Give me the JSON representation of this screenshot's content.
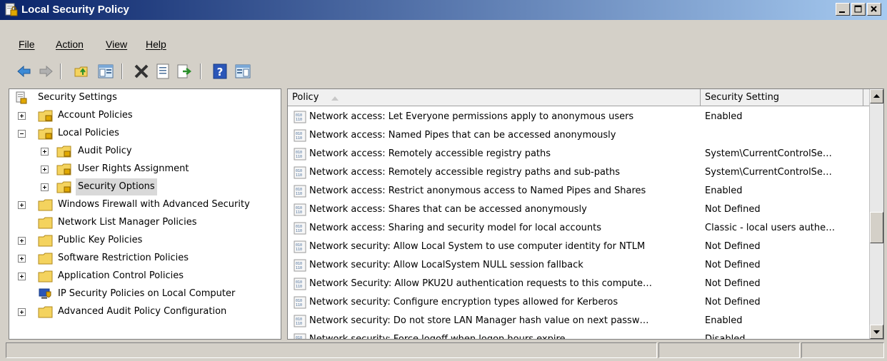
{
  "window": {
    "title": "Local Security Policy"
  },
  "menu": {
    "file": "File",
    "action": "Action",
    "view": "View",
    "help": "Help"
  },
  "toolbar": {
    "icons": [
      "back-arrow-icon",
      "forward-arrow-icon",
      "up-one-level-icon",
      "show-hide-console-tree-icon",
      "delete-icon",
      "properties-icon",
      "export-list-icon",
      "help-icon",
      "show-hide-action-pane-icon"
    ]
  },
  "tree": {
    "root": "Security Settings",
    "items": [
      {
        "label": "Account Policies",
        "expander": "+"
      },
      {
        "label": "Local Policies",
        "expander": "-"
      },
      {
        "label": "Audit Policy",
        "expander": "+"
      },
      {
        "label": "User Rights Assignment",
        "expander": "+"
      },
      {
        "label": "Security Options",
        "expander": "+",
        "selected": true
      },
      {
        "label": "Windows Firewall with Advanced Security",
        "expander": "+"
      },
      {
        "label": "Network List Manager Policies",
        "expander": ""
      },
      {
        "label": "Public Key Policies",
        "expander": "+"
      },
      {
        "label": "Software Restriction Policies",
        "expander": "+"
      },
      {
        "label": "Application Control Policies",
        "expander": "+"
      },
      {
        "label": "IP Security Policies on Local Computer",
        "expander": ""
      },
      {
        "label": "Advanced Audit Policy Configuration",
        "expander": "+"
      }
    ]
  },
  "list": {
    "columns": {
      "policy": "Policy",
      "setting": "Security Setting"
    },
    "rows": [
      {
        "policy": "Network access: Let Everyone permissions apply to anonymous users",
        "setting": "Enabled"
      },
      {
        "policy": "Network access: Named Pipes that can be accessed anonymously",
        "setting": ""
      },
      {
        "policy": "Network access: Remotely accessible registry paths",
        "setting": "System\\CurrentControlSe…"
      },
      {
        "policy": "Network access: Remotely accessible registry paths and sub-paths",
        "setting": "System\\CurrentControlSe…"
      },
      {
        "policy": "Network access: Restrict anonymous access to Named Pipes and Shares",
        "setting": "Enabled"
      },
      {
        "policy": "Network access: Shares that can be accessed anonymously",
        "setting": "Not Defined"
      },
      {
        "policy": "Network access: Sharing and security model for local accounts",
        "setting": "Classic - local users authe…"
      },
      {
        "policy": "Network security: Allow Local System to use computer identity for NTLM",
        "setting": "Not Defined"
      },
      {
        "policy": "Network security: Allow LocalSystem NULL session fallback",
        "setting": "Not Defined"
      },
      {
        "policy": "Network Security: Allow PKU2U authentication requests to this compute…",
        "setting": "Not Defined"
      },
      {
        "policy": "Network security: Configure encryption types allowed for Kerberos",
        "setting": "Not Defined"
      },
      {
        "policy": "Network security: Do not store LAN Manager hash value on next passw…",
        "setting": "Enabled"
      },
      {
        "policy": "Network security: Force logoff when logon hours expire",
        "setting": "Disabled"
      }
    ]
  },
  "colors": {
    "title_bar_start": "#0a246a",
    "title_bar_end": "#a6caf0",
    "chrome": "#d4d0c8",
    "selected_bg": "#d9d9d9"
  }
}
